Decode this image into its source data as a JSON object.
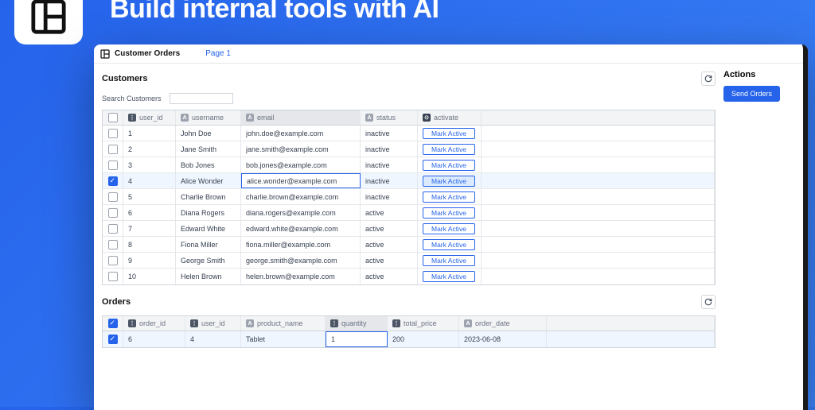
{
  "tagline": "Build internal tools with AI",
  "window": {
    "title": "Customer Orders",
    "page": "Page 1"
  },
  "sidebar": {
    "title": "Actions",
    "send_label": "Send Orders"
  },
  "customers": {
    "title": "Customers",
    "search_label": "Search Customers",
    "columns": {
      "user_id": "user_id",
      "username": "username",
      "email": "email",
      "status": "status",
      "activate": "activate"
    },
    "mark_active_label": "Mark Active",
    "selected_index": 3,
    "rows": [
      {
        "user_id": "1",
        "username": "John Doe",
        "email": "john.doe@example.com",
        "status": "inactive"
      },
      {
        "user_id": "2",
        "username": "Jane Smith",
        "email": "jane.smith@example.com",
        "status": "inactive"
      },
      {
        "user_id": "3",
        "username": "Bob Jones",
        "email": "bob.jones@example.com",
        "status": "inactive"
      },
      {
        "user_id": "4",
        "username": "Alice Wonder",
        "email": "alice.wonder@example.com",
        "status": "inactive"
      },
      {
        "user_id": "5",
        "username": "Charlie Brown",
        "email": "charlie.brown@example.com",
        "status": "inactive"
      },
      {
        "user_id": "6",
        "username": "Diana Rogers",
        "email": "diana.rogers@example.com",
        "status": "active"
      },
      {
        "user_id": "7",
        "username": "Edward White",
        "email": "edward.white@example.com",
        "status": "active"
      },
      {
        "user_id": "8",
        "username": "Fiona Miller",
        "email": "fiona.miller@example.com",
        "status": "active"
      },
      {
        "user_id": "9",
        "username": "George Smith",
        "email": "george.smith@example.com",
        "status": "active"
      },
      {
        "user_id": "10",
        "username": "Helen Brown",
        "email": "helen.brown@example.com",
        "status": "active"
      }
    ]
  },
  "orders": {
    "title": "Orders",
    "columns": {
      "order_id": "order_id",
      "user_id": "user_id",
      "product_name": "product_name",
      "quantity": "quantity",
      "total_price": "total_price",
      "order_date": "order_date"
    },
    "selected_index": 0,
    "rows": [
      {
        "order_id": "6",
        "user_id": "4",
        "product_name": "Tablet",
        "quantity": "1",
        "total_price": "200",
        "order_date": "2023-06-08"
      }
    ]
  }
}
